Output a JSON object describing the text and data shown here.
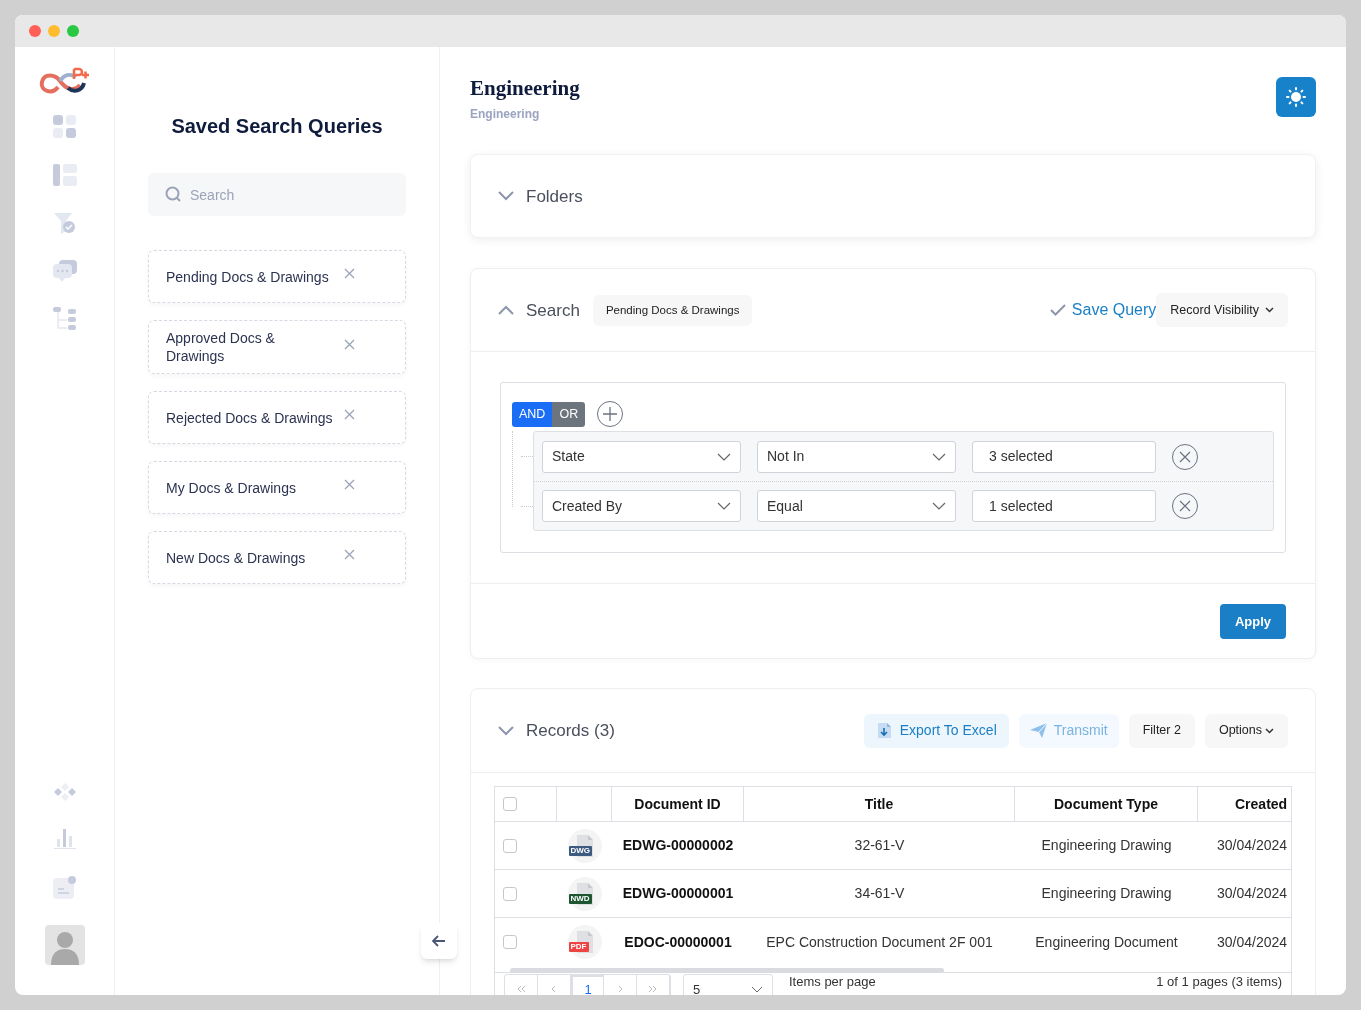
{
  "window": {
    "controls": [
      {
        "color": "#ff5f57"
      },
      {
        "color": "#febc2e"
      },
      {
        "color": "#28c840"
      }
    ]
  },
  "saved_queries": {
    "title": "Saved Search Queries",
    "search": {
      "placeholder": "Search"
    },
    "items": [
      {
        "label": "Pending Docs & Drawings"
      },
      {
        "label": "Approved Docs & Drawings"
      },
      {
        "label": "Rejected Docs & Drawings"
      },
      {
        "label": "My Docs & Drawings"
      },
      {
        "label": "New Docs & Drawings"
      }
    ]
  },
  "header": {
    "title": "Engineering",
    "subtitle": "Engineering"
  },
  "folders": {
    "title": "Folders",
    "expanded": false
  },
  "search": {
    "title": "Search",
    "expanded": true,
    "query_tag": "Pending Docs & Drawings",
    "save_label": "Save Query",
    "visibility_label": "Record Visibility",
    "conjunctions": [
      {
        "label": "AND",
        "selected": true
      },
      {
        "label": "OR",
        "selected": false
      }
    ],
    "rules": [
      {
        "field": "State",
        "operator": "Not In",
        "value": "3 selected"
      },
      {
        "field": "Created By",
        "operator": "Equal",
        "value": "1 selected"
      }
    ],
    "apply": "Apply"
  },
  "records": {
    "title": "Records (3)",
    "actions": [
      {
        "label": "Export To Excel",
        "kind": "export"
      },
      {
        "label": "Transmit",
        "kind": "transmit"
      },
      {
        "label": "Filter 2",
        "kind": "plain"
      },
      {
        "label": "Options",
        "kind": "menu"
      }
    ],
    "columns": [
      "Document ID",
      "Title",
      "Document Type",
      "Created"
    ],
    "select_all": {
      "checked": false
    },
    "rows": [
      {
        "checked": false,
        "file_type": "DWG",
        "color": "#3d5a80",
        "document_id": "EDWG-00000002",
        "title": "32-61-V",
        "document_type": "Engineering Drawing",
        "created": "30/04/2024"
      },
      {
        "checked": false,
        "file_type": "NWD",
        "color": "#1e5631",
        "document_id": "EDWG-00000001",
        "title": "34-61-V",
        "document_type": "Engineering Drawing",
        "created": "30/04/2024"
      },
      {
        "checked": false,
        "file_type": "PDF",
        "color": "#ef4444",
        "document_id": "EDOC-00000001",
        "title": "EPC Construction Document 2F 001",
        "document_type": "Engineering Document",
        "created": "30/04/2024"
      }
    ],
    "pagination": {
      "pages": [
        {
          "label": "1",
          "selected": true
        }
      ],
      "page_size": "5",
      "page_size_label": "Items per page",
      "summary": "1 of 1 pages (3 items)"
    }
  }
}
